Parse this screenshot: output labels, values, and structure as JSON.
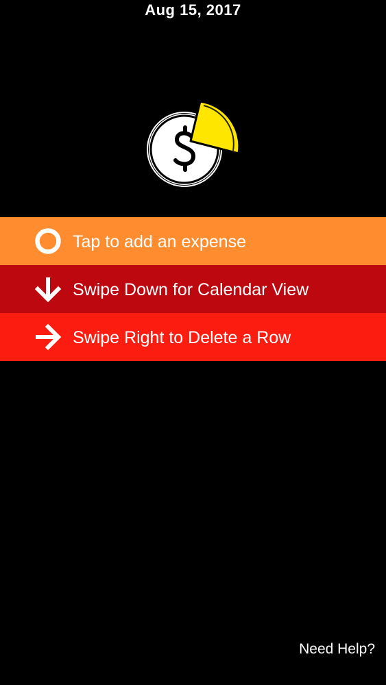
{
  "header": {
    "date": "Aug 15, 2017"
  },
  "logo": {
    "icon": "coin-pie-icon",
    "symbol": "$",
    "accent_color": "#ffe600"
  },
  "actions": [
    {
      "label": "Tap to add an expense",
      "icon": "circle-icon",
      "color": "#ff8c2e"
    },
    {
      "label": "Swipe Down for Calendar View",
      "icon": "arrow-down-icon",
      "color": "#bd0810"
    },
    {
      "label": "Swipe Right to Delete a Row",
      "icon": "arrow-right-icon",
      "color": "#fd1d10"
    }
  ],
  "footer": {
    "help_label": "Need Help?"
  }
}
